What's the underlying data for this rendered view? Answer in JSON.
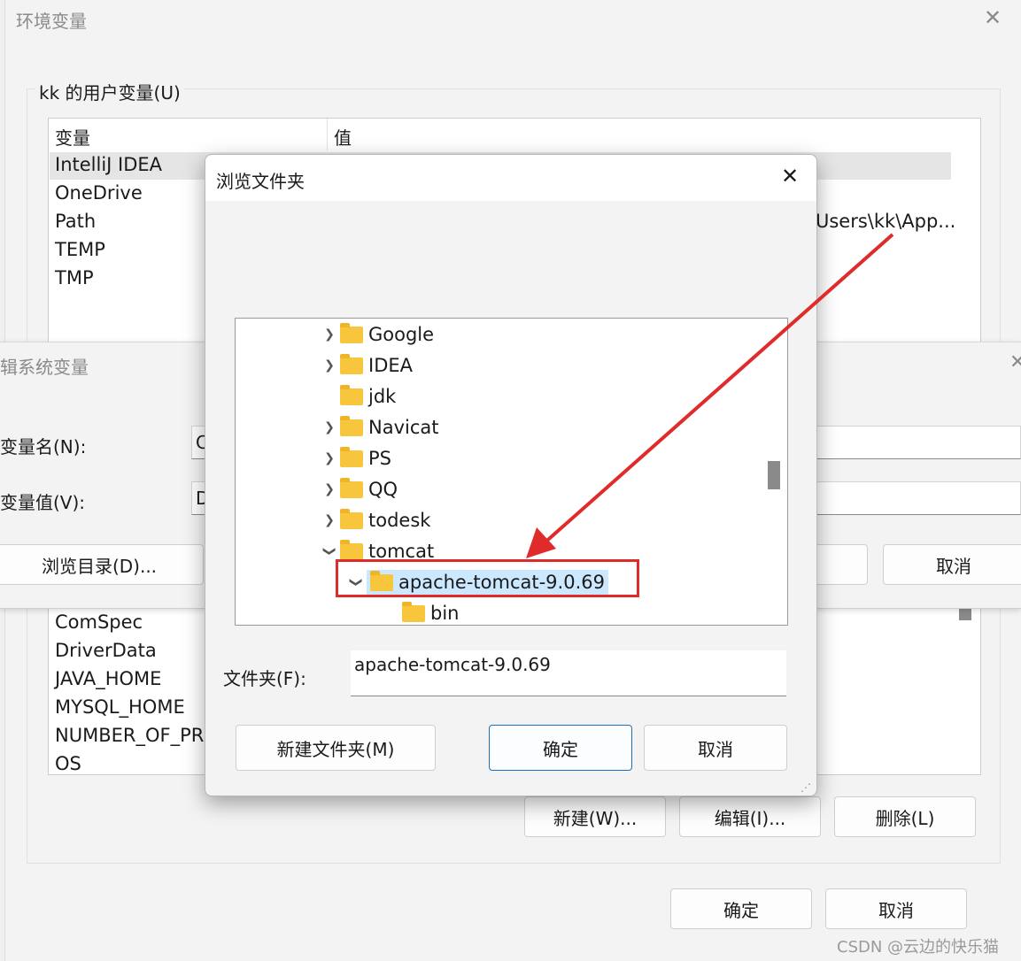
{
  "env_window": {
    "title": "环境变量",
    "user_group_label": "kk 的用户变量(U)",
    "col_variable": "变量",
    "col_value": "值",
    "user_vars": [
      "IntelliJ IDEA",
      "OneDrive",
      "Path",
      "TEMP",
      "TMP"
    ],
    "path_value_visible": "Users\\kk\\App...",
    "system_vars": [
      "ComSpec",
      "DriverData",
      "JAVA_HOME",
      "MYSQL_HOME",
      "NUMBER_OF_PRO",
      "OS"
    ],
    "new_button": "新建(W)...",
    "edit_button": "编辑(I)...",
    "delete_button": "删除(L)",
    "ok_button": "确定",
    "cancel_button": "取消"
  },
  "edit_dialog": {
    "title": "辑系统变量",
    "name_label": "变量名(N):",
    "value_label": "变量值(V):",
    "name_value_visible": "C",
    "value_value_visible": "D",
    "browse_dir_button": "浏览目录(D)...",
    "cancel_button": "取消"
  },
  "browse_dialog": {
    "title": "浏览文件夹",
    "tree": [
      {
        "label": "Google",
        "chevron": "right"
      },
      {
        "label": "IDEA",
        "chevron": "right"
      },
      {
        "label": "jdk",
        "chevron": "none"
      },
      {
        "label": "Navicat",
        "chevron": "right"
      },
      {
        "label": "PS",
        "chevron": "right"
      },
      {
        "label": "QQ",
        "chevron": "right"
      },
      {
        "label": "todesk",
        "chevron": "right"
      },
      {
        "label": "tomcat",
        "chevron": "down"
      },
      {
        "label": "apache-tomcat-9.0.69",
        "chevron": "down",
        "selected": true
      },
      {
        "label": "bin",
        "chevron": "none"
      }
    ],
    "folder_label": "文件夹(F):",
    "folder_value": "apache-tomcat-9.0.69",
    "new_folder_button": "新建文件夹(M)",
    "ok_button": "确定",
    "cancel_button": "取消"
  },
  "watermark": "CSDN @云边的快乐猫",
  "colors": {
    "annotation": "#e02b2b",
    "selection": "#cce8ff",
    "folder": "#f8c63d"
  }
}
